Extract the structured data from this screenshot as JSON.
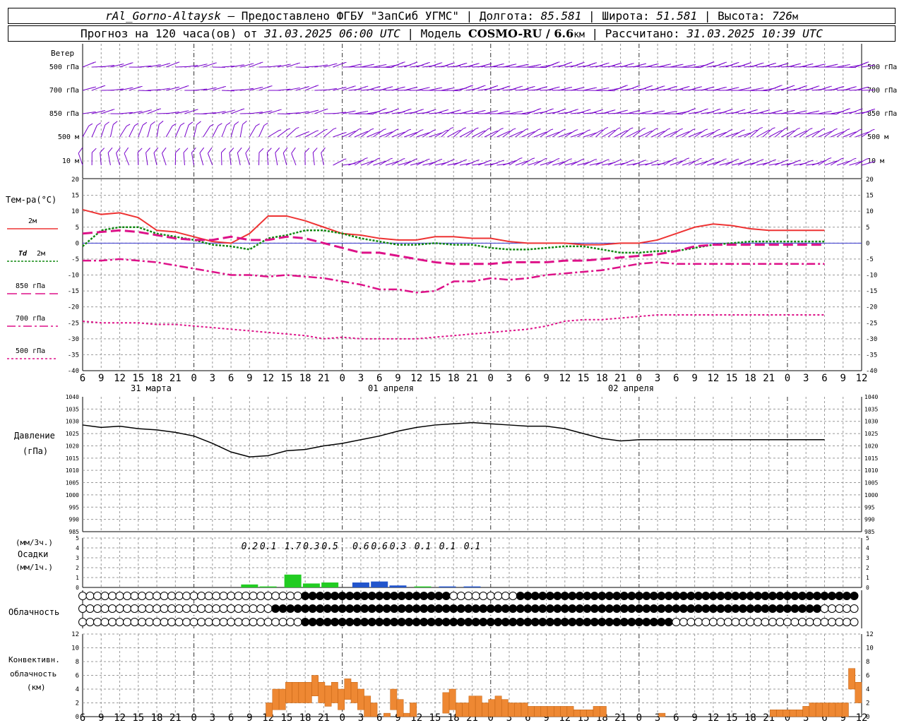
{
  "header": {
    "station": "rAl_Gorno-Altaysk",
    "provider": " – Предоставлено ФГБУ \"ЗапСиб УГМС\" | Долгота: ",
    "lon": "85.581",
    "lat_label": " | Широта: ",
    "lat": "51.581",
    "alt_label": " | Высота: ",
    "alt": "726",
    "alt_unit": "м",
    "forecast_label": "Прогноз на 120 часа(ов) от ",
    "forecast_time": "31.03.2025 06:00 UTC",
    "model_label": "  | Модель ",
    "model": "COSMO-RU / 6.6",
    "model_unit": "км",
    "calc_label": " | Рассчитано: ",
    "calc_time": "31.03.2025 10:39 UTC"
  },
  "labels": {
    "wind": "Ветер",
    "temp": "Тем-ра(°C)",
    "t2m": "2м",
    "td": "Td",
    "td2m": "2м",
    "t850": "850 гПа",
    "t700": "700 гПа",
    "t500": "500 гПа",
    "pressure": "Давление",
    "pressure_unit": "(гПа)",
    "precip_unit3": "(мм/3ч.)",
    "precip": "Осадки",
    "precip_unit1": "(мм/1ч.)",
    "clouds": "Облачность",
    "conv1": "Конвективн.",
    "conv2": "облачность",
    "conv_unit": "(км)",
    "day1": "31 марта",
    "day2": "01 апреля",
    "day3": "02 апреля"
  },
  "wind_levels": [
    "500 гПа",
    "700 гПа",
    "850 гПа",
    "500 м",
    "10  м"
  ],
  "colors": {
    "t2m": "#ee3333",
    "td": "#118811",
    "t850": "#dd1188",
    "t700": "#dd1188",
    "t500": "#dd1188",
    "pressure": "#000000",
    "wind": "#7700cc",
    "precip_green": "#22cc22",
    "precip_blue": "#2255cc",
    "conv": "#ee8833",
    "zero": "#3333cc"
  },
  "chart_data": [
    {
      "type": "line",
      "name": "temperature",
      "x_hours_from_start": [
        0,
        3,
        6,
        9,
        12,
        15,
        18,
        21,
        24,
        27,
        30,
        33,
        36,
        39,
        42,
        45,
        48,
        51,
        54,
        57,
        60,
        63,
        66,
        69,
        72,
        75,
        78,
        81,
        84,
        87,
        90,
        93,
        96,
        99,
        102,
        105,
        108,
        111,
        114,
        117,
        120
      ],
      "x_tick_labels": [
        "6",
        "9",
        "12",
        "15",
        "18",
        "21",
        "0",
        "3",
        "6",
        "9",
        "12",
        "15",
        "18",
        "21",
        "0",
        "3",
        "6",
        "9",
        "12",
        "15",
        "18",
        "21",
        "0",
        "3",
        "6",
        "9",
        "12",
        "15",
        "18",
        "21",
        "0",
        "3",
        "6",
        "9",
        "12",
        "15",
        "18",
        "21",
        "0",
        "3",
        "6",
        "9",
        "12"
      ],
      "ylim": [
        -40,
        20
      ],
      "y_ticks": [
        20,
        15,
        10,
        5,
        0,
        -5,
        -10,
        -15,
        -20,
        -25,
        -30,
        -35,
        -40
      ],
      "series": [
        {
          "name": "2м",
          "values": [
            10.5,
            9,
            9.5,
            8,
            4,
            3.5,
            2,
            0.5,
            0,
            3,
            8.5,
            8.5,
            7,
            5,
            3,
            2.5,
            1.5,
            1,
            1,
            2,
            2,
            1.5,
            1.5,
            0.5,
            0,
            0,
            0,
            -0.5,
            -0.5,
            0,
            0,
            1,
            3,
            5,
            6,
            5.5,
            4.5,
            4,
            4,
            4,
            4
          ]
        },
        {
          "name": "Td 2м",
          "values": [
            -1,
            4,
            5,
            5,
            3,
            2,
            1,
            -0.5,
            -1,
            -2,
            1.5,
            2.5,
            4,
            4,
            3,
            1.5,
            0.5,
            -0.5,
            -0.5,
            0,
            -0.5,
            -0.5,
            -1.5,
            -2,
            -2,
            -1.5,
            -1,
            -1,
            -2,
            -3,
            -3,
            -2.5,
            -2.5,
            -1.5,
            -0.5,
            0,
            0.5,
            0.5,
            0.5,
            0.5,
            0.5
          ]
        },
        {
          "name": "850 гПа",
          "values": [
            3,
            3.5,
            4,
            3.5,
            2.5,
            1.5,
            1,
            1,
            2,
            1,
            1,
            2,
            1.5,
            0,
            -1.5,
            -3,
            -3,
            -4,
            -5,
            -6,
            -6.5,
            -6.5,
            -6.5,
            -6,
            -6,
            -6,
            -5.5,
            -5.5,
            -5,
            -4.5,
            -4,
            -3.5,
            -2.5,
            -1,
            -0.5,
            -0.5,
            -0.5,
            -0.5,
            -0.5,
            -0.5,
            -0.5
          ]
        },
        {
          "name": "700 гПа",
          "values": [
            -5.5,
            -5.5,
            -5,
            -5.5,
            -6,
            -7,
            -8,
            -9,
            -10,
            -10,
            -10.5,
            -10,
            -10.5,
            -11,
            -12,
            -13,
            -14.5,
            -14.5,
            -15.5,
            -15,
            -12,
            -12,
            -11,
            -11.5,
            -11,
            -10,
            -9.5,
            -9,
            -8.5,
            -7.5,
            -6.5,
            -6,
            -6.5,
            -6.5,
            -6.5,
            -6.5,
            -6.5,
            -6.5,
            -6.5,
            -6.5,
            -6.5
          ]
        },
        {
          "name": "500 гПа",
          "values": [
            -24.5,
            -25,
            -25,
            -25,
            -25.5,
            -25.5,
            -26,
            -26.5,
            -27,
            -27.5,
            -28,
            -28.5,
            -29,
            -30,
            -29.5,
            -30,
            -30,
            -30,
            -30,
            -29.5,
            -29,
            -28.5,
            -28,
            -27.5,
            -27,
            -26,
            -24.5,
            -24,
            -24,
            -23.5,
            -23,
            -22.5,
            -22.5,
            -22.5,
            -22.5,
            -22.5,
            -22.5,
            -22.5,
            -22.5,
            -22.5,
            -22.5
          ]
        }
      ]
    },
    {
      "type": "line",
      "name": "pressure",
      "ylim": [
        985,
        1040
      ],
      "y_ticks": [
        1040,
        1035,
        1030,
        1025,
        1020,
        1015,
        1010,
        1005,
        1000,
        995,
        990,
        985
      ],
      "values": [
        1028.5,
        1027.5,
        1028,
        1027,
        1026.5,
        1025.5,
        1024,
        1021,
        1017.5,
        1015.5,
        1016,
        1018,
        1018.5,
        1020,
        1021,
        1022.5,
        1024,
        1026,
        1027.5,
        1028.5,
        1029,
        1029.5,
        1029,
        1028.5,
        1028,
        1028,
        1027,
        1025,
        1023,
        1022,
        1022.5,
        1022.5,
        1022.5,
        1022.5,
        1022.5,
        1022.5,
        1022.5,
        1022.5,
        1022.5,
        1022.5,
        1022.5
      ]
    },
    {
      "type": "bar",
      "name": "precipitation",
      "ylim": [
        0,
        5
      ],
      "labels_3h": [
        "0.2",
        "0.1",
        "1.7",
        "0.3",
        "0.5",
        "0.6",
        "0.6",
        "0.3",
        "0.1",
        "0.1",
        "0.1"
      ],
      "values_1h": [
        0.3,
        0.1,
        1.3,
        0.4,
        0.5,
        0.5,
        0.6,
        0.2,
        0.1,
        0.1,
        0.1
      ],
      "hours": [
        27,
        30,
        34,
        37,
        40,
        45,
        48,
        51,
        55,
        59,
        63
      ]
    },
    {
      "type": "bar",
      "name": "convective_clouds",
      "ylim": [
        0,
        12
      ],
      "values_km": [
        0,
        0,
        0,
        0,
        0,
        0,
        0,
        0,
        0,
        0,
        0,
        0,
        0,
        0,
        0,
        0,
        0,
        0,
        0,
        0,
        0,
        0,
        0,
        0,
        0,
        0,
        0,
        0,
        2,
        4,
        4,
        5,
        5,
        5,
        5,
        6,
        5,
        4.5,
        5,
        4,
        5.5,
        5,
        4,
        3,
        2,
        0,
        0.5,
        4,
        2.5,
        0.5,
        2,
        0,
        0,
        0,
        0,
        3.5,
        4,
        2,
        2,
        3,
        3,
        2,
        2.5,
        3,
        2.5,
        2,
        2,
        2,
        1.5,
        1.5,
        1.5,
        1.5,
        1.5,
        1.5,
        1.5,
        1,
        1,
        1,
        1.5,
        1.5,
        0,
        0,
        0,
        0,
        0,
        0,
        0,
        0,
        0.5,
        0,
        0,
        0,
        0,
        0,
        0,
        0,
        0,
        0,
        0,
        0,
        0,
        0,
        0,
        0,
        0,
        1,
        1,
        1,
        1,
        1,
        1.5,
        2,
        2,
        2,
        2,
        2,
        2,
        7,
        5
      ]
    }
  ]
}
